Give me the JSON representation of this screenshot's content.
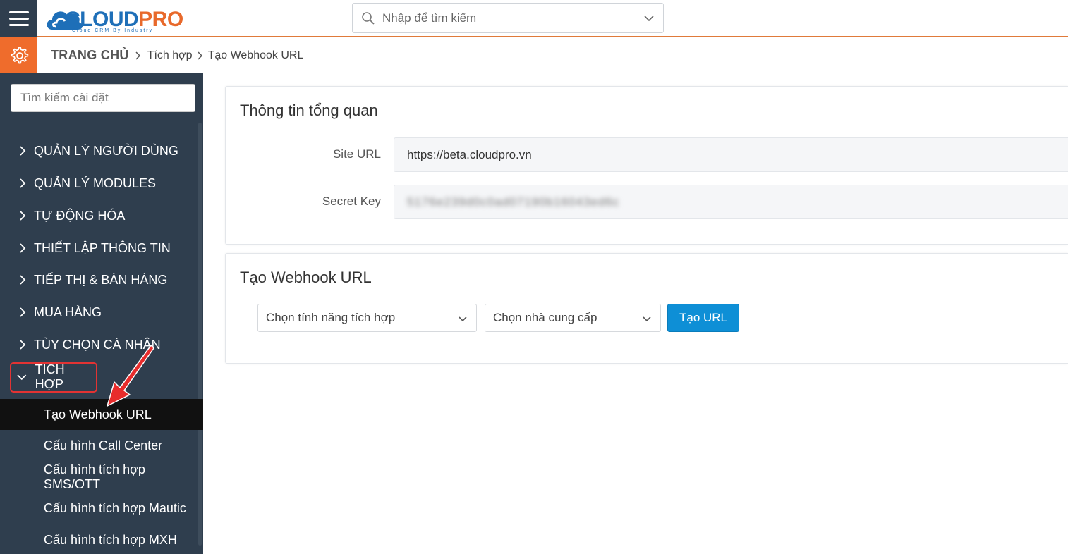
{
  "header": {
    "logo": {
      "part1": "CLOUD",
      "part2": "PRO",
      "tagline": "Cloud CRM By Industry"
    },
    "search_placeholder": "Nhập để tìm kiếm"
  },
  "breadcrumb": {
    "home": "TRANG CHỦ",
    "items": [
      "Tích hợp",
      "Tạo Webhook URL"
    ]
  },
  "sidebar": {
    "search_placeholder": "Tìm kiếm cài đặt",
    "menu": [
      {
        "label": "QUẢN LÝ NGƯỜI DÙNG"
      },
      {
        "label": "QUẢN LÝ MODULES"
      },
      {
        "label": "TỰ ĐỘNG HÓA"
      },
      {
        "label": "THIẾT LẬP THÔNG TIN"
      },
      {
        "label": "TIẾP THỊ & BÁN HÀNG"
      },
      {
        "label": "MUA HÀNG"
      },
      {
        "label": "TÙY CHỌN CÁ NHÂN"
      },
      {
        "label": "TÍCH HỢP"
      }
    ],
    "submenu": [
      {
        "label": "Tạo Webhook URL"
      },
      {
        "label": "Cấu hình Call Center"
      },
      {
        "label": "Cấu hình tích hợp SMS/OTT"
      },
      {
        "label": "Cấu hình tích hợp Mautic"
      },
      {
        "label": "Cấu hình tích hợp MXH"
      }
    ]
  },
  "overview": {
    "title": "Thông tin tổng quan",
    "site_url_label": "Site URL",
    "site_url_value": "https://beta.cloudpro.vn",
    "secret_key_label": "Secret Key",
    "secret_key_value": "5176e239d0c0ad07190b16043ed6c"
  },
  "webhook": {
    "title": "Tạo Webhook URL",
    "feature_select": "Chọn tính năng tích hợp",
    "provider_select": "Chọn nhà cung cấp",
    "create_button": "Tạo URL"
  },
  "colors": {
    "sidebar_bg": "#2f3e4e",
    "accent_orange": "#ef6c2c",
    "primary_blue": "#0e8fd6",
    "highlight_red": "#e23333"
  }
}
